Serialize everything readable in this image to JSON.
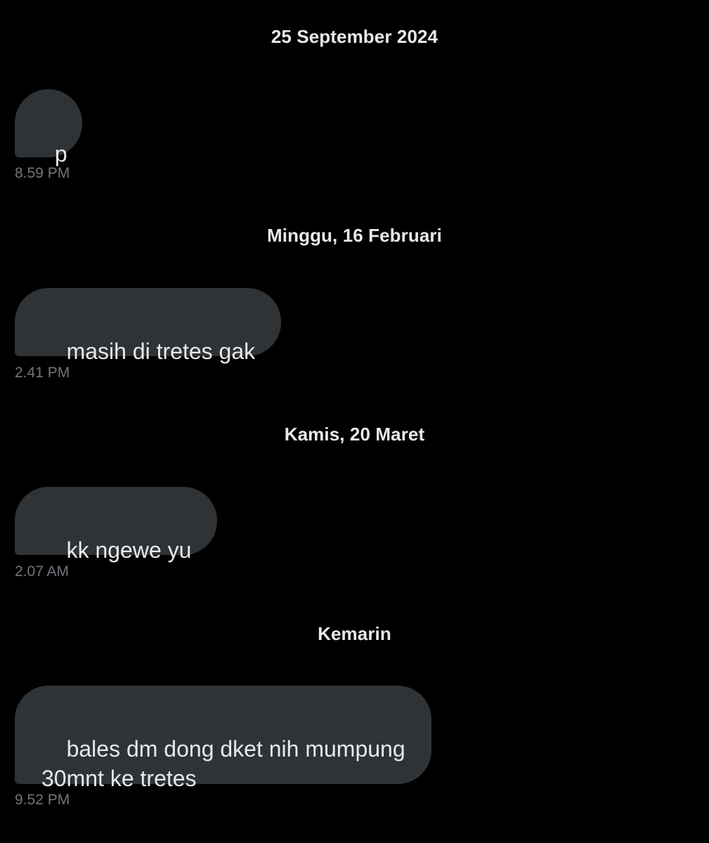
{
  "conversation": {
    "groups": [
      {
        "date_label": "25 September 2024",
        "message": "p",
        "time": "8.59 PM"
      },
      {
        "date_label": "Minggu, 16 Februari",
        "message": "masih di tretes gak",
        "time": "2.41 PM"
      },
      {
        "date_label": "Kamis, 20 Maret",
        "message": "kk ngewe yu",
        "time": "2.07 AM"
      },
      {
        "date_label": "Kemarin",
        "message": "bales dm dong dket nih mumpung\n30mnt ke tretes",
        "time": "9.52 PM"
      }
    ]
  },
  "colors": {
    "background": "#000000",
    "bubble": "#2f3336",
    "text": "#e7e9ea",
    "timestamp": "#71767b"
  }
}
